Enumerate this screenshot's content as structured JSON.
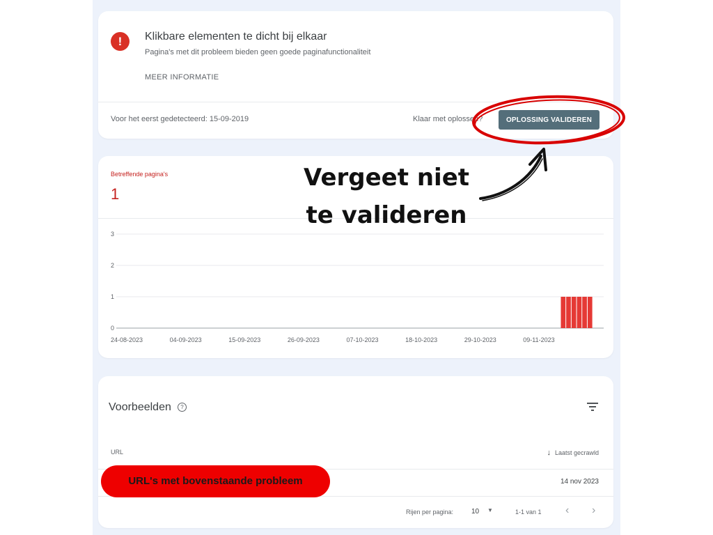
{
  "issue": {
    "title": "Klikbare elementen te dicht bij elkaar",
    "subtitle": "Pagina's met dit probleem bieden geen goede paginafunctionaliteit",
    "more_info": "MEER INFORMATIE",
    "first_detected": "Voor het eerst gedetecteerd: 15-09-2019",
    "done_prompt": "Klaar met oplossen?",
    "validate_button": "OPLOSSING VALIDEREN",
    "icon": "error-icon"
  },
  "summary": {
    "label": "Betreffende pagina's",
    "value": "1"
  },
  "chart_data": {
    "type": "bar",
    "x_tick_labels": [
      "24-08-2023",
      "04-09-2023",
      "15-09-2023",
      "26-09-2023",
      "07-10-2023",
      "18-10-2023",
      "29-10-2023",
      "09-11-2023"
    ],
    "x_start": "2023-08-24",
    "x_tick_dates": [
      "2023-08-24",
      "2023-09-04",
      "2023-09-15",
      "2023-09-26",
      "2023-10-07",
      "2023-10-18",
      "2023-10-29",
      "2023-11-09"
    ],
    "x_end": "2023-11-23",
    "x": [
      "2023-11-15",
      "2023-11-16",
      "2023-11-17",
      "2023-11-18",
      "2023-11-19",
      "2023-11-20"
    ],
    "values": [
      1,
      1,
      1,
      1,
      1,
      1
    ],
    "ylim": [
      0,
      3
    ],
    "y_ticks": [
      0,
      1,
      2,
      3
    ],
    "grid": true,
    "bar_color": "#e53935"
  },
  "examples": {
    "title": "Voorbeelden",
    "help_icon": "help-icon",
    "filter_icon": "filter-icon",
    "col_url": "URL",
    "col_crawled": "Laatst gecrawld",
    "rows": [
      {
        "url": "",
        "date": "14 nov 2023"
      }
    ],
    "rows_per_page_label": "Rijen per pagina:",
    "rows_per_page_value": "10",
    "range": "1-1 van 1"
  },
  "annotation": {
    "line1": "Vergeet niet",
    "line2": "te valideren",
    "pill": "URL's met bovenstaande probleem",
    "highlight_color": "#d80000"
  }
}
